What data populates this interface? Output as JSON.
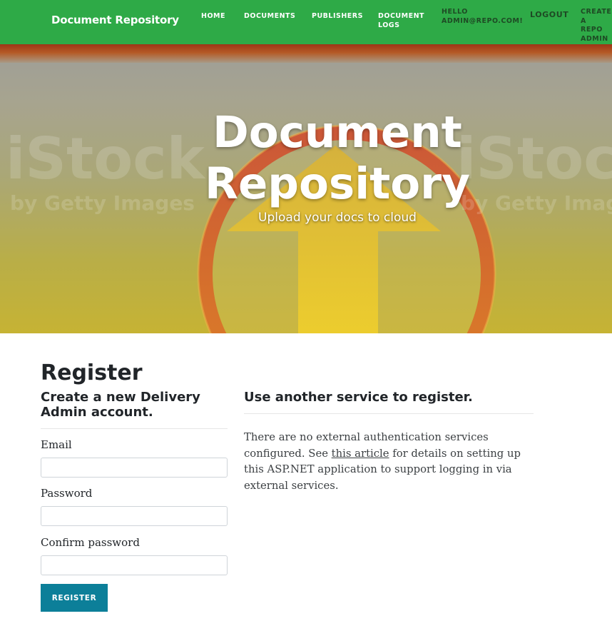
{
  "nav": {
    "brand": "Document Repository",
    "home": "HOME",
    "documents": "DOCUMENTS",
    "publishers": "PUBLISHERS",
    "document_logs": "DOCUMENT\nLOGS",
    "hello": "HELLO\nADMIN@REPO.COM!",
    "logout": "LOGOUT",
    "create_admin": "CREATE A\nREPO\nADMIN"
  },
  "hero": {
    "title_line1": "Document",
    "title_line2": "Repository",
    "subtitle": "Upload your docs to cloud",
    "watermark_main": "iStock",
    "watermark_sub": "by Getty Images"
  },
  "page": {
    "heading": "Register",
    "subheading": "Create a new Delivery Admin account."
  },
  "form": {
    "email_label": "Email",
    "email_value": "",
    "password_label": "Password",
    "password_value": "",
    "confirm_label": "Confirm password",
    "confirm_value": "",
    "submit_label": "REGISTER"
  },
  "external": {
    "heading": "Use another service to register.",
    "text_before": "There are no external authentication services configured. See ",
    "link_text": "this article",
    "text_after": " for details on setting up this ASP.NET application to support logging in via external services."
  },
  "colors": {
    "navbar": "#2eaa47",
    "button": "#0c7f99",
    "arrow": "#e8c22e",
    "ring": "#d9572a"
  }
}
